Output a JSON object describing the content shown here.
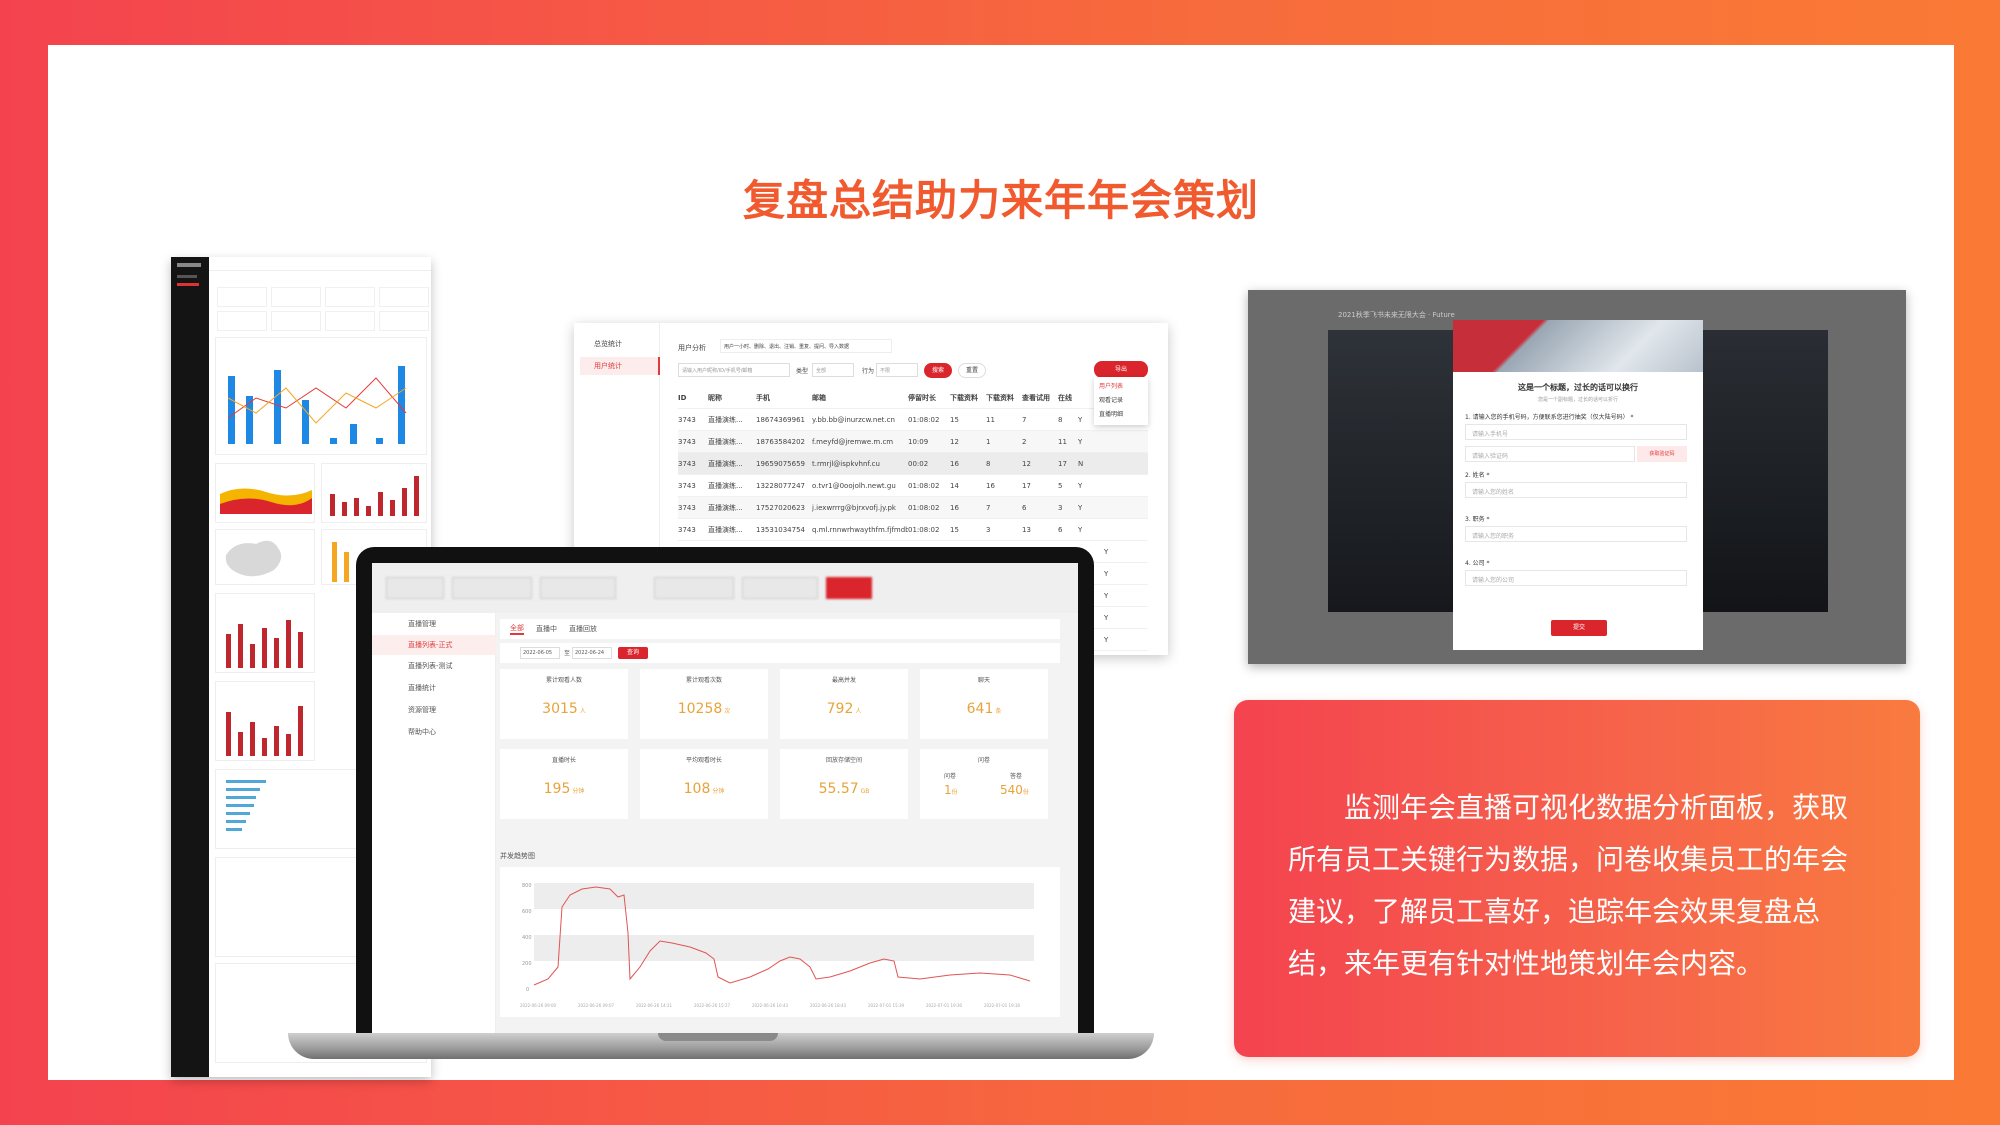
{
  "slide": {
    "title": "复盘总结助力来年年会策划",
    "description": "监测年会直播可视化数据分析面板，获取所有员工关键行为数据，问卷收集员工的年会建议，了解员工喜好，追踪年会效果复盘总结，来年更有针对性地策划年会内容。"
  },
  "table_screenshot": {
    "nav": [
      "总览统计",
      "用户统计"
    ],
    "section_title": "用户分析",
    "tip": "用户一小时、删除、退出、注销、重复、提问、导入数据",
    "search_placeholder": "请输入用户昵称/ID/手机号/邮箱",
    "filter_type_label": "类型",
    "filter_type_value": "全部",
    "filter_behavior_label": "行为",
    "filter_behavior_value": "不限",
    "search_button": "搜索",
    "reset_button": "重置",
    "export_button": "导出",
    "export_menu": [
      "用户列表",
      "观看记录",
      "直播明细"
    ],
    "columns": [
      "ID",
      "昵称",
      "手机",
      "邮箱",
      "停留时长",
      "下载资料",
      "下载资料",
      "查看试用",
      "在线"
    ],
    "rows": [
      [
        "3743",
        "直播演练...",
        "18674369961",
        "y.bb.bb@inurzcw.net.cn",
        "01:08:02",
        "15",
        "11",
        "7",
        "8"
      ],
      [
        "3743",
        "直播演练...",
        "18763584202",
        "f.meyfd@jremwe.m.cm",
        "10:09",
        "12",
        "1",
        "2",
        "11"
      ],
      [
        "3743",
        "直播演练...",
        "19659075659",
        "t.rmrjl@ispkvhnf.cu",
        "00:02",
        "16",
        "8",
        "12",
        "17"
      ],
      [
        "3743",
        "直播演练...",
        "13228077247",
        "o.tvr1@0oojolh.newt.gu",
        "01:08:02",
        "14",
        "16",
        "17",
        "5"
      ],
      [
        "3743",
        "直播演练...",
        "17527020623",
        "j.iexwrrrg@bjrxvofj.jy.pk",
        "01:08:02",
        "16",
        "7",
        "6",
        "3"
      ],
      [
        "3743",
        "直播演练...",
        "13531034754",
        "q.ml.rnnwrhwaythfm.fjfmdbe.ve",
        "01:08:02",
        "15",
        "3",
        "13",
        "6"
      ]
    ],
    "trailing_marks": [
      "Y",
      "Y",
      "N",
      "Y",
      "Y",
      "Y",
      "Y",
      "Y",
      "Y",
      "Y",
      "Y"
    ]
  },
  "laptop": {
    "nav": [
      "直播管理",
      "直播列表-正式",
      "直播列表-测试",
      "直播统计",
      "资源管理",
      "帮助中心"
    ],
    "tabs": [
      "全部",
      "直播中",
      "直播回放"
    ],
    "date_from": "2022-06-05",
    "date_to_label": "至",
    "date_to": "2022-06-24",
    "query_button": "查询",
    "tiles_row1": [
      {
        "label": "累计观看人数",
        "value": "3015",
        "unit": "人"
      },
      {
        "label": "累计观看次数",
        "value": "10258",
        "unit": "次"
      },
      {
        "label": "最高并发",
        "value": "792",
        "unit": "人"
      },
      {
        "label": "聊天",
        "value": "641",
        "unit": "条"
      }
    ],
    "tiles_row2": [
      {
        "label": "直播时长",
        "value": "195",
        "unit": "分钟"
      },
      {
        "label": "平均观看时长",
        "value": "108",
        "unit": "分钟"
      },
      {
        "label": "回放存储空间",
        "value": "55.57",
        "unit": "GB"
      }
    ],
    "questionnaire": {
      "label": "问卷",
      "left_label": "问卷",
      "left_value": "1",
      "left_unit": "份",
      "right_label": "答卷",
      "right_value": "540",
      "right_unit": "份"
    },
    "chart_title": "并发趋势图",
    "chart_y_ticks": [
      "800",
      "600",
      "400",
      "200",
      "0"
    ],
    "chart_x_ticks": [
      "2022-06-26 09:00",
      "2022-06-26 09:07",
      "2022-06-26 14:21",
      "2022-06-26 15:27",
      "2022-06-26 16:43",
      "2022-06-26 18:43",
      "2022-07-01 15:39",
      "2022-07-01 19:30",
      "2022-07-01 19:30"
    ]
  },
  "modal": {
    "page_title": "2021秋季飞书未来无限大会 · Future",
    "title": "这是一个标题，过长的话可以换行",
    "subtitle": "您是一个副标题，过长的话可以折行",
    "q1": "1. 请输入您的手机号码，方便联系您进行抽奖（仅大陆号码） *",
    "q1_placeholder": "请输入手机号",
    "code_placeholder": "请输入验证码",
    "code_button": "获取验证码",
    "q2": "2. 姓名 *",
    "q2_placeholder": "请输入您的姓名",
    "q3": "3. 职务 *",
    "q3_placeholder": "请输入您的职务",
    "q4": "4. 公司 *",
    "q4_placeholder": "请输入您的公司",
    "submit": "提交"
  },
  "colors": {
    "accent": "#f05a2e",
    "brand_red": "#d9252b",
    "gradient_start": "#f4434f",
    "gradient_end": "#fa7a35",
    "stat_value": "#e8a33a"
  }
}
